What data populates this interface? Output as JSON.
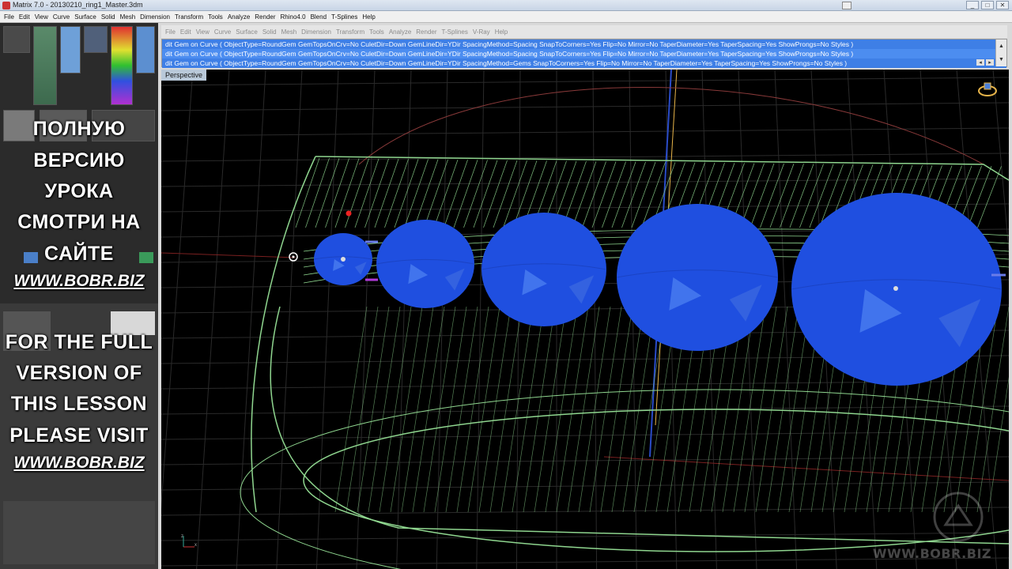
{
  "window": {
    "title": "Matrix 7.0 - 20130210_ring1_Master.3dm",
    "controls": [
      "_",
      "□",
      "✕"
    ]
  },
  "main_menu": [
    "File",
    "Edit",
    "View",
    "Curve",
    "Surface",
    "Solid",
    "Mesh",
    "Dimension",
    "Transform",
    "Tools",
    "Analyze",
    "Render",
    "Rhino4.0",
    "Blend",
    "T-Splines",
    "Help"
  ],
  "inner_menu": [
    "File",
    "Edit",
    "View",
    "Curve",
    "Surface",
    "Solid",
    "Mesh",
    "Dimension",
    "Transform",
    "Tools",
    "Analyze",
    "Render",
    "T-Splines",
    "V-Ray",
    "Help"
  ],
  "command_history": [
    "dit Gem on Curve ( ObjectType=RoundGem  GemTopsOnCrv=No  CuletDir=Down  GemLineDir=YDir  SpacingMethod=Spacing  SnapToCorners=Yes  Flip=No  Mirror=No  TaperDiameter=Yes  TaperSpacing=Yes  ShowProngs=No  Styles )",
    "dit Gem on Curve ( ObjectType=RoundGem  GemTopsOnCrv=No  CuletDir=Down  GemLineDir=YDir  SpacingMethod=Spacing  SnapToCorners=Yes  Flip=No  Mirror=No  TaperDiameter=Yes  TaperSpacing=Yes  ShowProngs=No  Styles )",
    "dit Gem on Curve ( ObjectType=RoundGem  GemTopsOnCrv=No  CuletDir=Down  GemLineDir=YDir  SpacingMethod=Gems  SnapToCorners=Yes  Flip=No  Mirror=No  TaperDiameter=Yes  TaperSpacing=Yes  ShowProngs=No  Styles )"
  ],
  "viewport": {
    "label": "Perspective",
    "watermark": "WWW.BOBR.BIZ",
    "axis_labels": {
      "x": "x",
      "y": "y",
      "z": "z"
    }
  },
  "overlay": {
    "ru_lines": [
      "ПОЛНУЮ",
      "ВЕРСИЮ",
      "УРОКА",
      "СМОТРИ НА",
      "САЙТЕ"
    ],
    "ru_link": "WWW.BOBR.BIZ",
    "en_lines": [
      "FOR THE FULL",
      "VERSION OF",
      "THIS LESSON",
      "PLEASE VISIT"
    ],
    "en_link": "WWW.BOBR.BIZ"
  },
  "colors": {
    "gem": "#1f4fe0",
    "wireframe": "#8fd68f",
    "command_highlight": "#3e7fe6",
    "viewport_label_bg": "#b9c9d9"
  }
}
